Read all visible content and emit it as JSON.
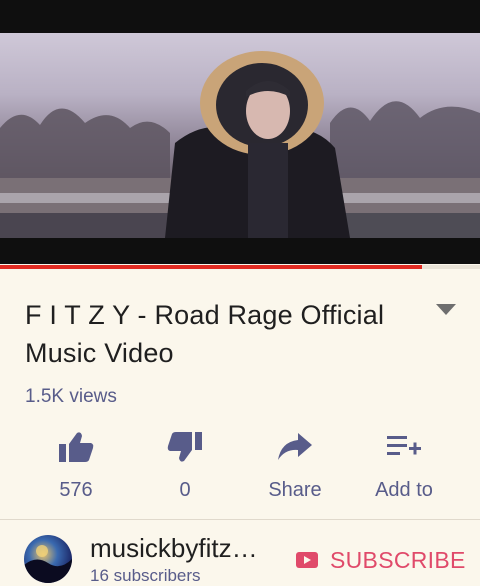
{
  "video": {
    "progress_fraction": 0.88,
    "accent_color": "#e22b22"
  },
  "title": {
    "spaced_name": "F I T Z Y",
    "rest": " - Road Rage Official Music Video"
  },
  "views": "1.5K views",
  "actions": [
    {
      "icon": "thumbs-up-icon",
      "label": "576"
    },
    {
      "icon": "thumbs-down-icon",
      "label": "0"
    },
    {
      "icon": "share-icon",
      "label": "Share"
    },
    {
      "icon": "playlist-add-icon",
      "label": "Add to"
    }
  ],
  "channel": {
    "name": "musickbyfitz…",
    "subscribers": "16 subscribers",
    "subscribe_label": "SUBSCRIBE",
    "subscribe_color": "#e04a6a"
  }
}
